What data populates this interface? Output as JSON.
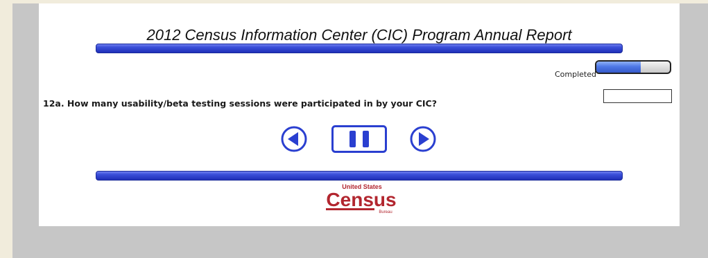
{
  "survey": {
    "title": "2012 Census Information Center (CIC) Program Annual Report",
    "question": "12a. How many usability/beta testing sessions were participated in by your CIC?",
    "answer_value": ""
  },
  "progress": {
    "label": "Completed",
    "fraction": 0.6
  },
  "navigation": {
    "prev_icon": "arrow-left-circle-icon",
    "pause_icon": "pause-icon",
    "next_icon": "arrow-right-circle-icon"
  },
  "logo": {
    "line1": "United States",
    "line2": "Census",
    "line3": "Bureau"
  },
  "colors": {
    "accent": "#2a3fd0",
    "page_bg": "#f1ecdc",
    "frame_bg": "#c6c6c6",
    "logo_red": "#b2262f"
  }
}
